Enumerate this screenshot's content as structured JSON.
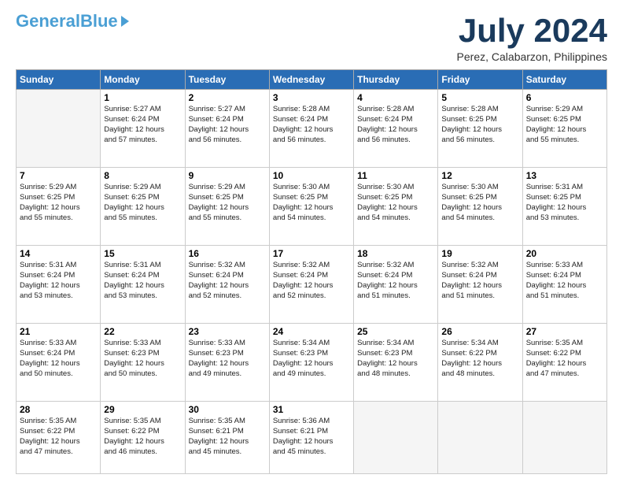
{
  "header": {
    "logo_general": "General",
    "logo_blue": "Blue",
    "main_title": "July 2024",
    "subtitle": "Perez, Calabarzon, Philippines"
  },
  "calendar": {
    "days_of_week": [
      "Sunday",
      "Monday",
      "Tuesday",
      "Wednesday",
      "Thursday",
      "Friday",
      "Saturday"
    ],
    "weeks": [
      [
        {
          "day": "",
          "info": ""
        },
        {
          "day": "1",
          "info": "Sunrise: 5:27 AM\nSunset: 6:24 PM\nDaylight: 12 hours\nand 57 minutes."
        },
        {
          "day": "2",
          "info": "Sunrise: 5:27 AM\nSunset: 6:24 PM\nDaylight: 12 hours\nand 56 minutes."
        },
        {
          "day": "3",
          "info": "Sunrise: 5:28 AM\nSunset: 6:24 PM\nDaylight: 12 hours\nand 56 minutes."
        },
        {
          "day": "4",
          "info": "Sunrise: 5:28 AM\nSunset: 6:24 PM\nDaylight: 12 hours\nand 56 minutes."
        },
        {
          "day": "5",
          "info": "Sunrise: 5:28 AM\nSunset: 6:25 PM\nDaylight: 12 hours\nand 56 minutes."
        },
        {
          "day": "6",
          "info": "Sunrise: 5:29 AM\nSunset: 6:25 PM\nDaylight: 12 hours\nand 55 minutes."
        }
      ],
      [
        {
          "day": "7",
          "info": "Sunrise: 5:29 AM\nSunset: 6:25 PM\nDaylight: 12 hours\nand 55 minutes."
        },
        {
          "day": "8",
          "info": "Sunrise: 5:29 AM\nSunset: 6:25 PM\nDaylight: 12 hours\nand 55 minutes."
        },
        {
          "day": "9",
          "info": "Sunrise: 5:29 AM\nSunset: 6:25 PM\nDaylight: 12 hours\nand 55 minutes."
        },
        {
          "day": "10",
          "info": "Sunrise: 5:30 AM\nSunset: 6:25 PM\nDaylight: 12 hours\nand 54 minutes."
        },
        {
          "day": "11",
          "info": "Sunrise: 5:30 AM\nSunset: 6:25 PM\nDaylight: 12 hours\nand 54 minutes."
        },
        {
          "day": "12",
          "info": "Sunrise: 5:30 AM\nSunset: 6:25 PM\nDaylight: 12 hours\nand 54 minutes."
        },
        {
          "day": "13",
          "info": "Sunrise: 5:31 AM\nSunset: 6:25 PM\nDaylight: 12 hours\nand 53 minutes."
        }
      ],
      [
        {
          "day": "14",
          "info": "Sunrise: 5:31 AM\nSunset: 6:24 PM\nDaylight: 12 hours\nand 53 minutes."
        },
        {
          "day": "15",
          "info": "Sunrise: 5:31 AM\nSunset: 6:24 PM\nDaylight: 12 hours\nand 53 minutes."
        },
        {
          "day": "16",
          "info": "Sunrise: 5:32 AM\nSunset: 6:24 PM\nDaylight: 12 hours\nand 52 minutes."
        },
        {
          "day": "17",
          "info": "Sunrise: 5:32 AM\nSunset: 6:24 PM\nDaylight: 12 hours\nand 52 minutes."
        },
        {
          "day": "18",
          "info": "Sunrise: 5:32 AM\nSunset: 6:24 PM\nDaylight: 12 hours\nand 51 minutes."
        },
        {
          "day": "19",
          "info": "Sunrise: 5:32 AM\nSunset: 6:24 PM\nDaylight: 12 hours\nand 51 minutes."
        },
        {
          "day": "20",
          "info": "Sunrise: 5:33 AM\nSunset: 6:24 PM\nDaylight: 12 hours\nand 51 minutes."
        }
      ],
      [
        {
          "day": "21",
          "info": "Sunrise: 5:33 AM\nSunset: 6:24 PM\nDaylight: 12 hours\nand 50 minutes."
        },
        {
          "day": "22",
          "info": "Sunrise: 5:33 AM\nSunset: 6:23 PM\nDaylight: 12 hours\nand 50 minutes."
        },
        {
          "day": "23",
          "info": "Sunrise: 5:33 AM\nSunset: 6:23 PM\nDaylight: 12 hours\nand 49 minutes."
        },
        {
          "day": "24",
          "info": "Sunrise: 5:34 AM\nSunset: 6:23 PM\nDaylight: 12 hours\nand 49 minutes."
        },
        {
          "day": "25",
          "info": "Sunrise: 5:34 AM\nSunset: 6:23 PM\nDaylight: 12 hours\nand 48 minutes."
        },
        {
          "day": "26",
          "info": "Sunrise: 5:34 AM\nSunset: 6:22 PM\nDaylight: 12 hours\nand 48 minutes."
        },
        {
          "day": "27",
          "info": "Sunrise: 5:35 AM\nSunset: 6:22 PM\nDaylight: 12 hours\nand 47 minutes."
        }
      ],
      [
        {
          "day": "28",
          "info": "Sunrise: 5:35 AM\nSunset: 6:22 PM\nDaylight: 12 hours\nand 47 minutes."
        },
        {
          "day": "29",
          "info": "Sunrise: 5:35 AM\nSunset: 6:22 PM\nDaylight: 12 hours\nand 46 minutes."
        },
        {
          "day": "30",
          "info": "Sunrise: 5:35 AM\nSunset: 6:21 PM\nDaylight: 12 hours\nand 45 minutes."
        },
        {
          "day": "31",
          "info": "Sunrise: 5:36 AM\nSunset: 6:21 PM\nDaylight: 12 hours\nand 45 minutes."
        },
        {
          "day": "",
          "info": ""
        },
        {
          "day": "",
          "info": ""
        },
        {
          "day": "",
          "info": ""
        }
      ]
    ]
  }
}
